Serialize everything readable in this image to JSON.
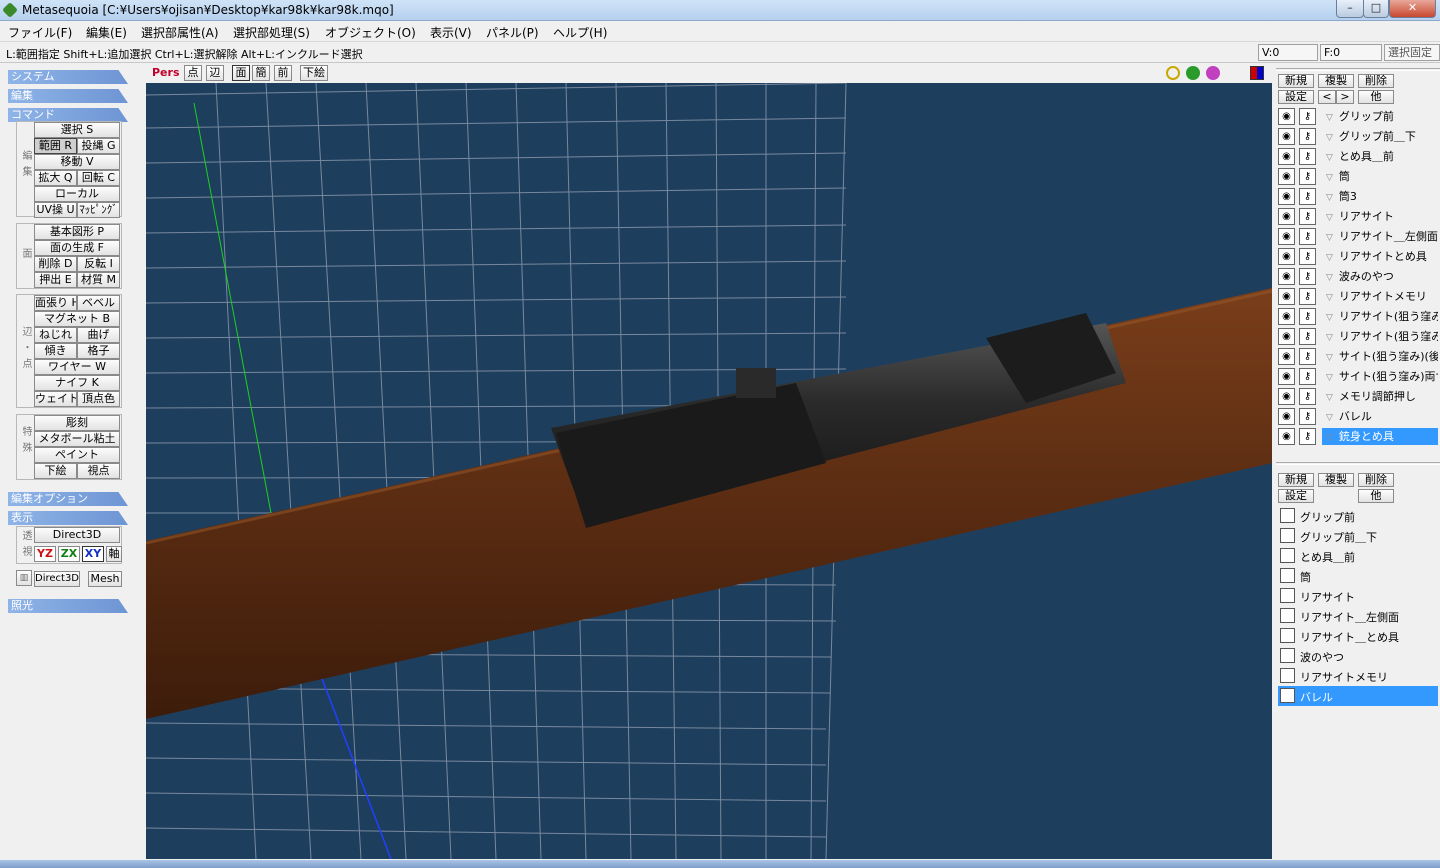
{
  "window": {
    "title": "Metasequoia [C:¥Users¥ojisan¥Desktop¥kar98k¥kar98k.mqo]",
    "min": "–",
    "max": "□",
    "close": "✕"
  },
  "menu": [
    "ファイル(F)",
    "編集(E)",
    "選択部属性(A)",
    "選択部処理(S)",
    "オブジェクト(O)",
    "表示(V)",
    "パネル(P)",
    "ヘルプ(H)"
  ],
  "status": {
    "hint": "L:範囲指定  Shift+L:追加選択  Ctrl+L:選択解除  Alt+L:インクルード選択",
    "v": "V:0",
    "f": "F:0",
    "fix": "選択固定"
  },
  "left": {
    "sections": {
      "system": "システム",
      "edit": "編集",
      "command": "コマンド",
      "edit_option": "編集オプション",
      "display": "表示",
      "light": "照光"
    },
    "group_labels": {
      "edit": "編集",
      "face": "面",
      "edge": "辺・点",
      "special": "特殊",
      "transparent": "透視"
    },
    "cmds": {
      "select": "選択 S",
      "range": "範囲 R",
      "lasso": "投縄 G",
      "move": "移動 V",
      "scale": "拡大 Q",
      "rotate": "回転 C",
      "local": "ローカル",
      "uv": "UV操 U",
      "mapping": "ﾏｯﾋﾟﾝｸﾞ",
      "primitive": "基本図形 P",
      "face_gen": "面の生成 F",
      "delete": "削除 D",
      "invert": "反転 I",
      "extrude": "押出 E",
      "material": "材質 M",
      "stretch": "面張り H",
      "bevel": "ベベル",
      "magnet": "マグネット B",
      "twist": "ねじれ",
      "bend": "曲げ",
      "tilt": "傾き",
      "lattice": "格子",
      "wire": "ワイヤー W",
      "knife": "ナイフ K",
      "weight": "ウェイト",
      "vcolor": "頂点色",
      "carve": "彫刻",
      "metaball": "メタボール粘土",
      "paint": "ペイント",
      "underlay": "下絵",
      "viewpoint": "視点"
    },
    "display": {
      "direct3d": "Direct3D",
      "yz": "YZ",
      "zx": "ZX",
      "xy": "XY",
      "axis": "軸",
      "direct3d_small": "Direct3D",
      "mesh": "Mesh"
    },
    "colors": {
      "yz": "#d01010",
      "zx": "#108010",
      "xy": "#1030c0"
    }
  },
  "viewport": {
    "mode": "Pers",
    "buttons": [
      "点",
      "辺",
      "面",
      "簡",
      "前",
      "下絵"
    ],
    "colors": {
      "bg": "#1e3e5e",
      "grid": "#9aa8b8",
      "wood": "#5a2f14",
      "metal": "#222"
    }
  },
  "objects_panel": {
    "btn_new": "新規",
    "btn_copy": "複製",
    "btn_del": "削除",
    "btn_set": "設定",
    "btn_prev": "<",
    "btn_next": ">",
    "btn_other": "他",
    "eye_icon": "eye-icon",
    "lock_icon": "lock-icon",
    "items": [
      "グリップ前",
      "グリップ前＿下",
      "とめ具＿前",
      "筒",
      "筒3",
      "リアサイト",
      "リアサイト＿左側面",
      "リアサイトとめ具",
      "波みのやつ",
      "リアサイトメモリ",
      "リアサイト(狙う窪み)",
      "リアサイト(狙う窪み)",
      "サイト(狙う窪み)(後ろ",
      "サイト(狙う窪み)両サ",
      "メモリ調節押し",
      "バレル",
      "銃身とめ具"
    ],
    "selected_index": 16
  },
  "materials_panel": {
    "btn_new": "新規",
    "btn_copy": "複製",
    "btn_del": "削除",
    "btn_set": "設定",
    "btn_other": "他",
    "items": [
      "グリップ前",
      "グリップ前＿下",
      "とめ具＿前",
      "筒",
      "リアサイト",
      "リアサイト＿左側面",
      "リアサイト＿とめ具",
      "波のやつ",
      "リアサイトメモリ",
      "バレル"
    ],
    "selected_index": 9
  }
}
